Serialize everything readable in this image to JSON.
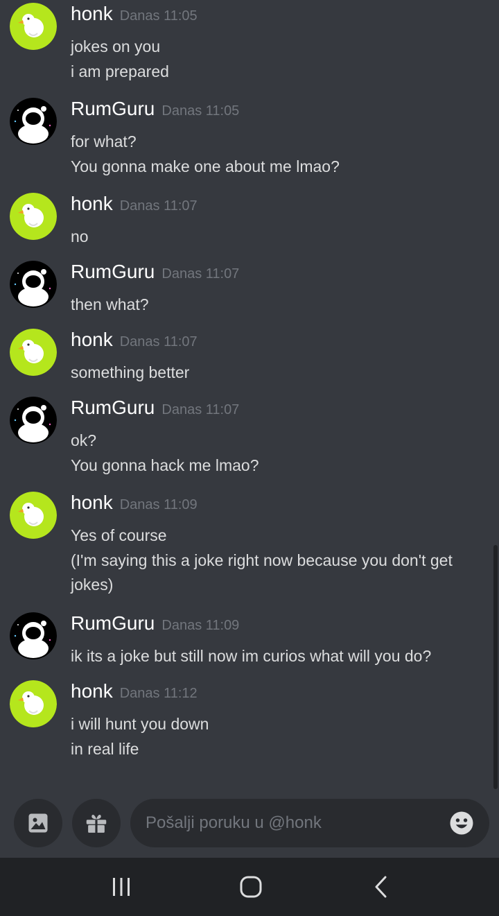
{
  "messages": [
    {
      "author": "honk",
      "time": "Danas 11:05",
      "avatar": "goose-avatar",
      "lines": [
        "jokes on you",
        "i am prepared"
      ]
    },
    {
      "author": "RumGuru",
      "time": "Danas 11:05",
      "avatar": "astronaut-avatar",
      "lines": [
        "for what?",
        "You gonna make one about me lmao?"
      ]
    },
    {
      "author": "honk",
      "time": "Danas 11:07",
      "avatar": "goose-avatar",
      "lines": [
        "no"
      ]
    },
    {
      "author": "RumGuru",
      "time": "Danas 11:07",
      "avatar": "astronaut-avatar",
      "lines": [
        "then what?"
      ]
    },
    {
      "author": "honk",
      "time": "Danas 11:07",
      "avatar": "goose-avatar",
      "lines": [
        "something better"
      ]
    },
    {
      "author": "RumGuru",
      "time": "Danas 11:07",
      "avatar": "astronaut-avatar",
      "lines": [
        "ok?",
        "You gonna hack me lmao?"
      ]
    },
    {
      "author": "honk",
      "time": "Danas 11:09",
      "avatar": "goose-avatar",
      "lines": [
        "Yes of course",
        "(I'm saying this a joke right now because you don't get",
        "jokes)"
      ]
    },
    {
      "author": "RumGuru",
      "time": "Danas 11:09",
      "avatar": "astronaut-avatar",
      "lines": [
        "ik its a joke but still now im curios what will you do?"
      ]
    },
    {
      "author": "honk",
      "time": "Danas 11:12",
      "avatar": "goose-avatar",
      "lines": [
        "i will hunt you down",
        "in real life"
      ]
    }
  ],
  "composer": {
    "placeholder": "Pošalji poruku u @honk",
    "image_button_icon": "image-icon",
    "gift_button_icon": "gift-icon",
    "emoji_button_icon": "emoji-icon"
  },
  "navbar": {
    "icons": [
      "recent-apps-icon",
      "home-icon",
      "back-icon"
    ]
  },
  "colors": {
    "background": "#36393f",
    "goose_avatar_bg": "#b5e61d",
    "composer_bg": "#292b2f",
    "navbar_bg": "#202225"
  }
}
